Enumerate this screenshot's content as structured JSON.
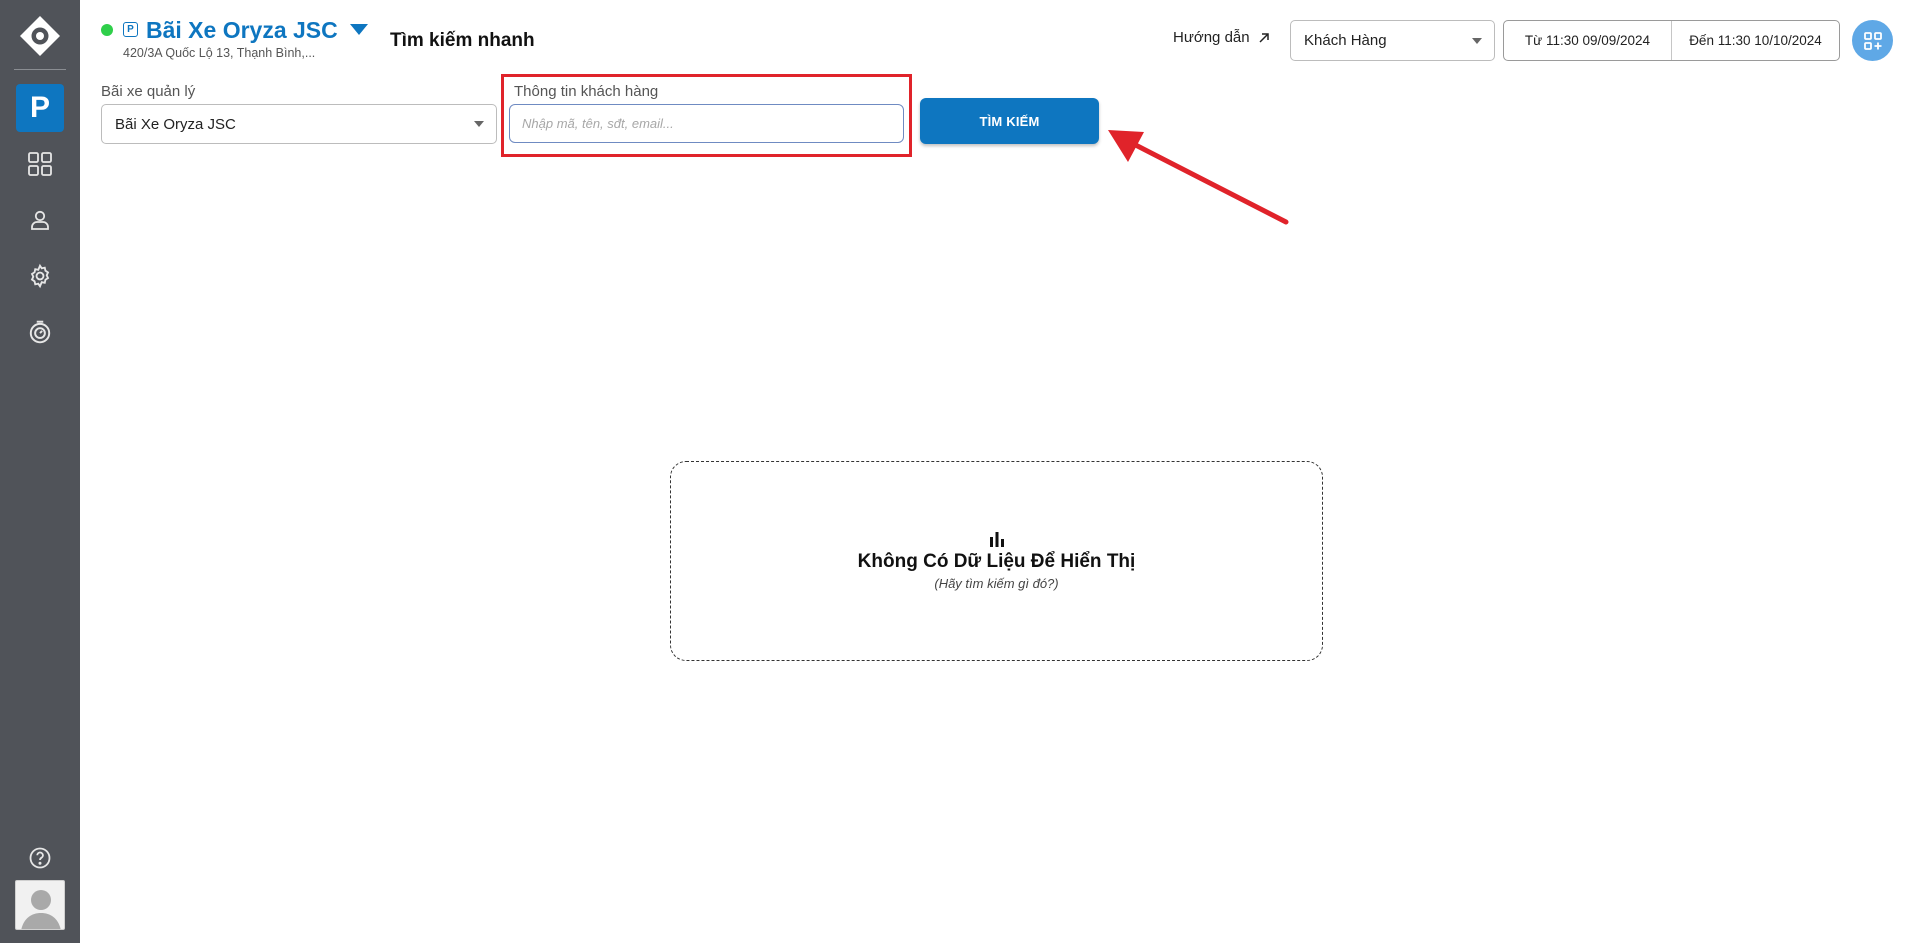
{
  "header": {
    "lot_badge": "P",
    "lot_name": "Bãi Xe Oryza JSC",
    "lot_address": "420/3A Quốc Lộ 13, Thạnh Bình,...",
    "page_title": "Tìm kiếm nhanh",
    "guide_label": "Hướng dẫn",
    "category_select": "Khách Hàng",
    "date_from": "Từ 11:30 09/09/2024",
    "date_to": "Đến 11:30 10/10/2024"
  },
  "sidebar": {
    "active_label": "P",
    "items": [
      "dashboard-icon",
      "user-icon",
      "gear-icon",
      "history-icon"
    ],
    "bottom": [
      "help-icon",
      "avatar"
    ]
  },
  "filters": {
    "lot_label": "Bãi xe quản lý",
    "lot_value": "Bãi Xe Oryza JSC",
    "customer_label": "Thông tin khách hàng",
    "customer_placeholder": "Nhập mã, tên, sđt, email...",
    "search_button": "TÌM KIẾM"
  },
  "empty_state": {
    "icon": "bar-chart-icon",
    "title": "Không Có Dữ Liệu Để Hiển Thị",
    "subtitle": "(Hãy tìm kiếm gì đó?)"
  },
  "colors": {
    "brand": "#0e76c0",
    "sidebar": "#505359",
    "status_online": "#2fcf4a",
    "highlight": "#e0232a"
  }
}
